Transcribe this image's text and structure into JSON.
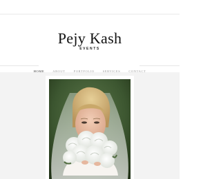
{
  "site": {
    "title": "Pejy Kash",
    "subtitle": "EVENTS"
  },
  "nav": {
    "items": [
      {
        "label": "HOME",
        "active": true
      },
      {
        "label": "ABOUT",
        "active": false
      },
      {
        "label": "PORTFOLIO",
        "active": false
      },
      {
        "label": "SERVICES",
        "active": false
      },
      {
        "label": "CONTACT",
        "active": false
      }
    ]
  },
  "colors": {
    "page_background": "#ffffff",
    "content_background": "#f3f3f3",
    "nav_text": "#999999",
    "nav_active_text": "#333333",
    "photo_background": "#3f5a33"
  },
  "hero": {
    "subject": "bride-with-white-roses-bouquet"
  }
}
